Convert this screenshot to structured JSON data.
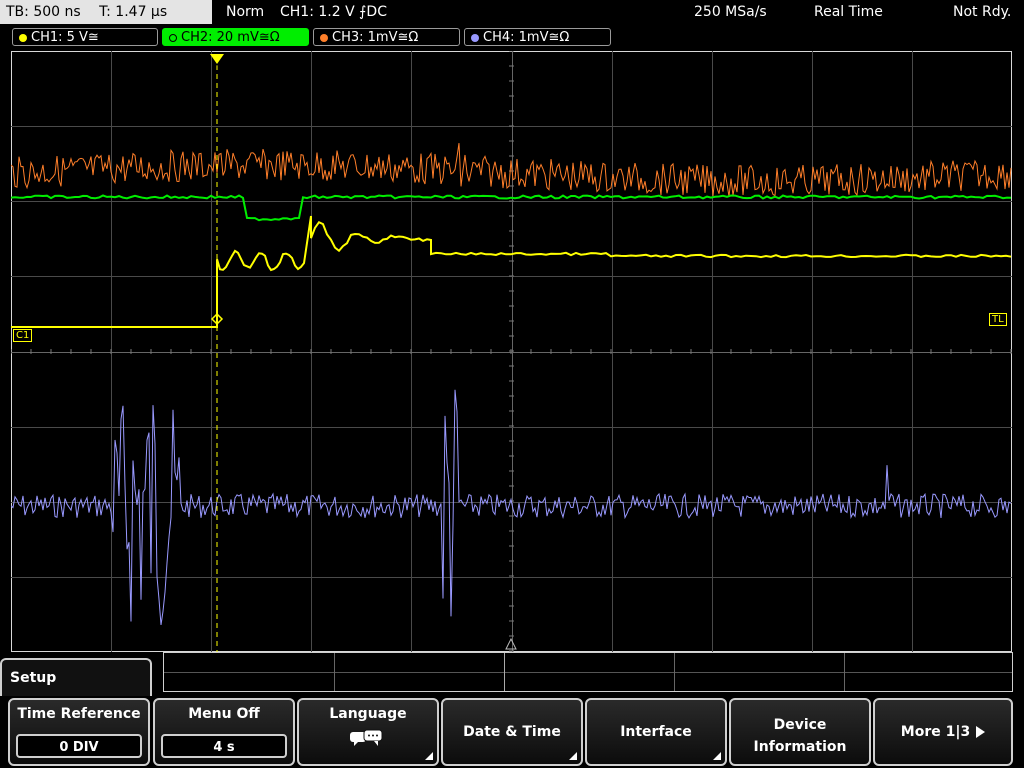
{
  "topbar": {
    "timebase": "TB: 500 ns",
    "trigger_time": "T: 1.47 µs",
    "mode": "Norm",
    "trigger_info": "CH1: 1.2 V ⨍DC",
    "sample_rate": "250 MSa/s",
    "acquisition": "Real Time",
    "status": "Not Rdy."
  },
  "channels": [
    {
      "label": "CH1: 5 V≅",
      "color": "#ffff00",
      "active": false
    },
    {
      "label": "CH2: 20 mV≅Ω",
      "color": "#00ee00",
      "active": true
    },
    {
      "label": "CH3: 1mV≅Ω",
      "color": "#ff7f2a",
      "active": false
    },
    {
      "label": "CH4: 1mV≅Ω",
      "color": "#9999ff",
      "active": false
    }
  ],
  "markers": {
    "c1": "C1",
    "tl": "TL",
    "trigger_t": "T"
  },
  "menu": {
    "title": "Setup",
    "softkeys": [
      {
        "label": "Time Reference",
        "value": "0 DIV"
      },
      {
        "label": "Menu Off",
        "value": "4 s"
      },
      {
        "label": "Language",
        "icon": "speech-bubbles-icon"
      },
      {
        "label": "Date & Time"
      },
      {
        "label": "Interface"
      },
      {
        "label_line1": "Device",
        "label_line2": "Information"
      },
      {
        "label": "More 1|3"
      }
    ]
  }
}
